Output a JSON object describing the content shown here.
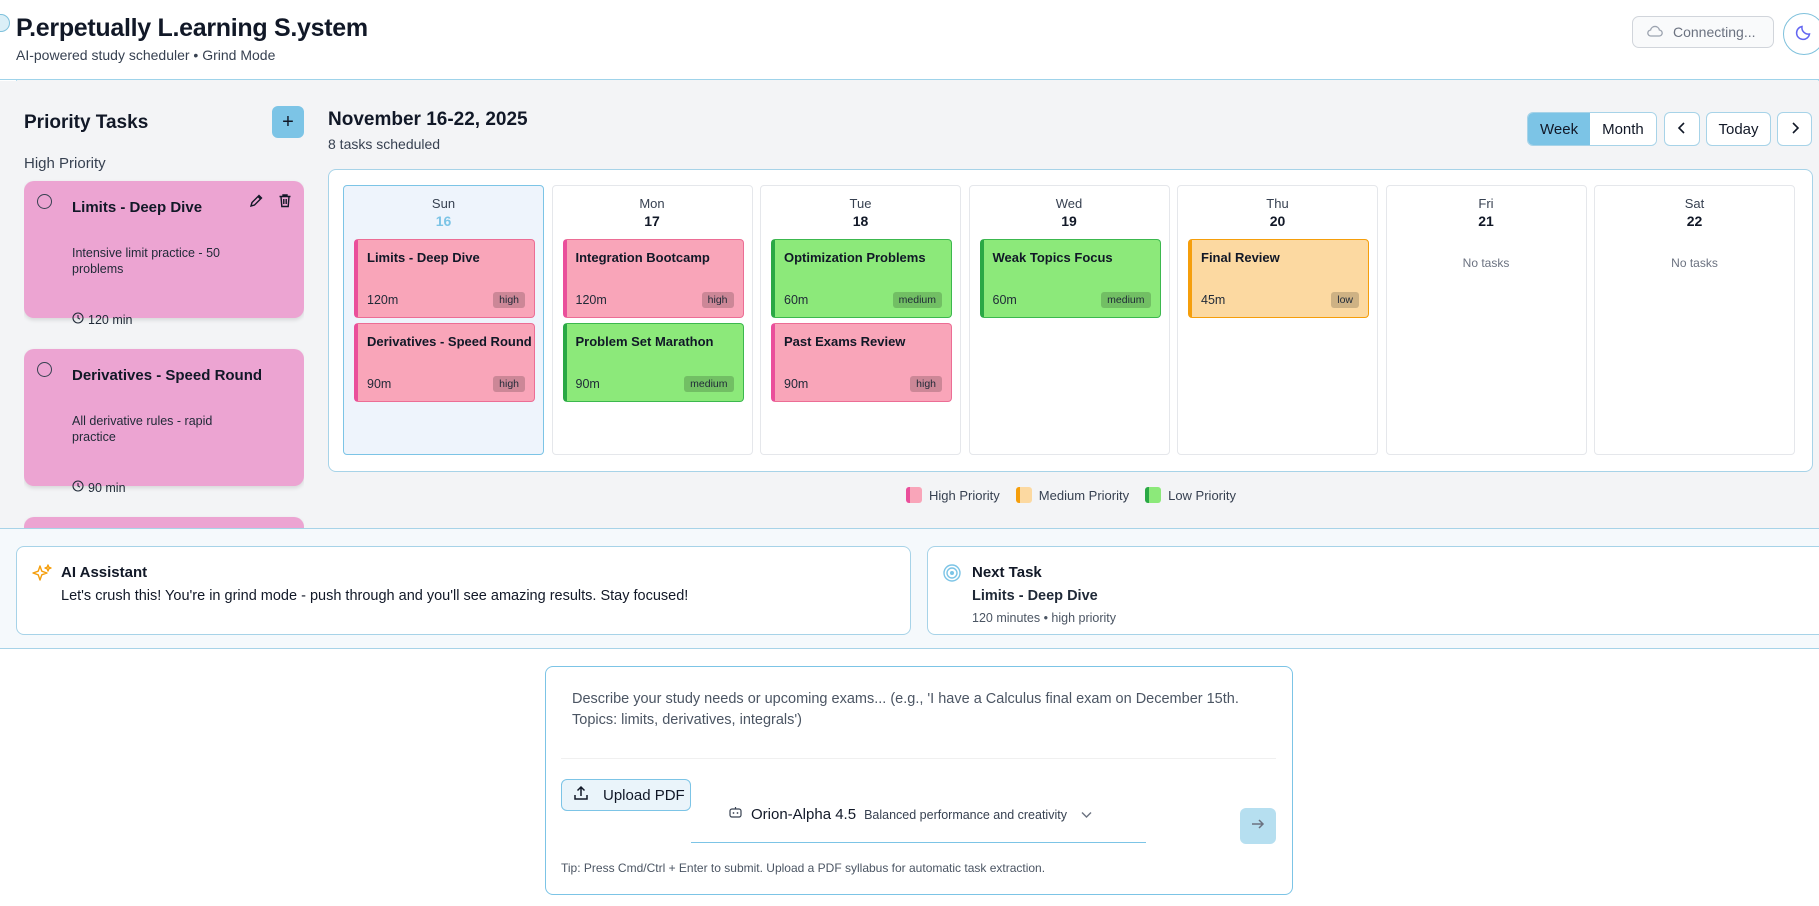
{
  "header": {
    "title": "P.erpetually L.earning S.ystem",
    "subtitle": "AI-powered study scheduler • Grind Mode",
    "connection_status": "Connecting...",
    "theme_icon": "moon-icon"
  },
  "sidebar": {
    "title": "Priority Tasks",
    "add_icon": "plus-icon",
    "group_label": "High Priority",
    "tasks": [
      {
        "title": "Limits - Deep Dive",
        "description": "Intensive limit practice - 50 problems",
        "duration": "120 min"
      },
      {
        "title": "Derivatives - Speed Round",
        "description": "All derivative rules - rapid practice",
        "duration": "90 min"
      }
    ]
  },
  "calendar": {
    "range_title": "November 16-22, 2025",
    "task_count": "8 tasks scheduled",
    "views": [
      "Week",
      "Month"
    ],
    "active_view": "Week",
    "today_label": "Today",
    "no_tasks_label": "No tasks",
    "days": [
      {
        "name": "Sun",
        "date": "16",
        "today": true,
        "events": [
          {
            "title": "Limits - Deep Dive",
            "duration": "120m",
            "priority": "high"
          },
          {
            "title": "Derivatives - Speed Round",
            "duration": "90m",
            "priority": "high"
          }
        ]
      },
      {
        "name": "Mon",
        "date": "17",
        "events": [
          {
            "title": "Integration Bootcamp",
            "duration": "120m",
            "priority": "high"
          },
          {
            "title": "Problem Set Marathon",
            "duration": "90m",
            "priority": "medium"
          }
        ]
      },
      {
        "name": "Tue",
        "date": "18",
        "events": [
          {
            "title": "Optimization Problems",
            "duration": "60m",
            "priority": "medium"
          },
          {
            "title": "Past Exams Review",
            "duration": "90m",
            "priority": "high"
          }
        ]
      },
      {
        "name": "Wed",
        "date": "19",
        "events": [
          {
            "title": "Weak Topics Focus",
            "duration": "60m",
            "priority": "medium"
          }
        ]
      },
      {
        "name": "Thu",
        "date": "20",
        "events": [
          {
            "title": "Final Review",
            "duration": "45m",
            "priority": "low"
          }
        ]
      },
      {
        "name": "Fri",
        "date": "21",
        "events": []
      },
      {
        "name": "Sat",
        "date": "22",
        "events": []
      }
    ],
    "legend": [
      {
        "label": "High Priority",
        "color": "#f9a5b9",
        "border": "#ea4f9b"
      },
      {
        "label": "Medium Priority",
        "color": "#fcd9a1",
        "border": "#f59e0b"
      },
      {
        "label": "Low Priority",
        "color": "#8ce97a",
        "border": "#2aa845"
      }
    ]
  },
  "assistant": {
    "title": "AI Assistant",
    "message": "Let's crush this! You're in grind mode - push through and you'll see amazing results. Stay focused!"
  },
  "next_task": {
    "title": "Next Task",
    "name": "Limits - Deep Dive",
    "meta": "120 minutes • high priority"
  },
  "input": {
    "placeholder": "Describe your study needs or upcoming exams... (e.g., 'I have a Calculus final exam on December 15th. Topics: limits, derivatives, integrals')",
    "upload_label": "Upload PDF",
    "model_name": "Orion-Alpha 4.5",
    "model_desc": "Balanced performance and creativity",
    "tip": "Tip: Press Cmd/Ctrl + Enter to submit. Upload a PDF syllabus for automatic task extraction."
  },
  "colors": {
    "accent": "#7cc4e6",
    "high": "#f9a5b9",
    "medium_green": "#8ce97a",
    "low_orange": "#fcd9a1",
    "sidebar_card": "#eca4d2"
  }
}
